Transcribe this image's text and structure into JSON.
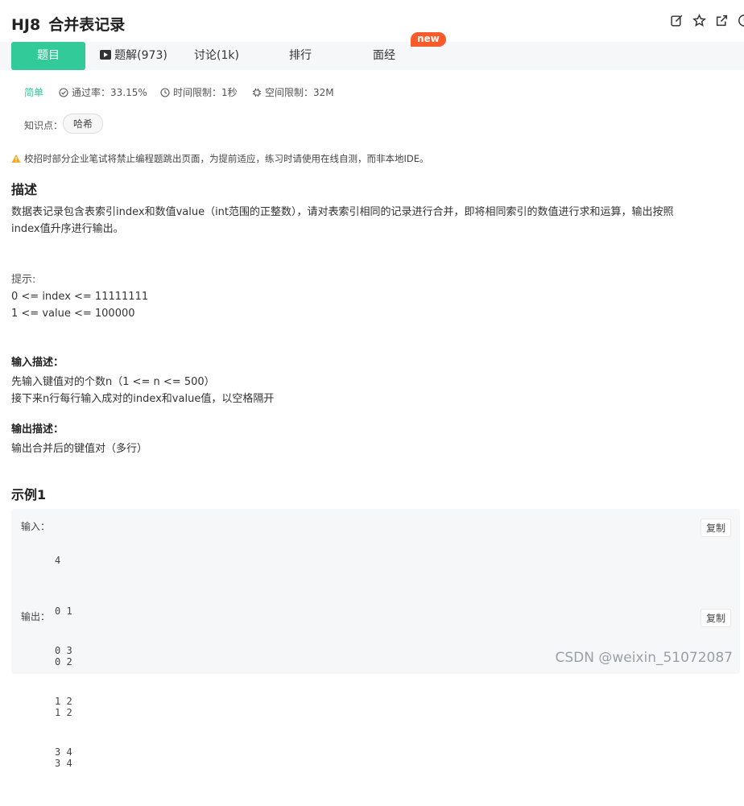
{
  "problem": {
    "id": "HJ8",
    "title": "合并表记录"
  },
  "tabs": [
    {
      "label": "题目",
      "active": true
    },
    {
      "label": "题解(973)"
    },
    {
      "label": "讨论(1k)"
    },
    {
      "label": "排行"
    },
    {
      "label": "面经"
    }
  ],
  "badge": "new",
  "meta": {
    "difficulty": "简单",
    "pass_rate": "通过率：33.15%",
    "time_limit": "时间限制：1秒",
    "space_limit": "空间限制：32M"
  },
  "knowledge": {
    "label": "知识点：",
    "tags": [
      "哈希"
    ]
  },
  "warning": "校招时部分企业笔试将禁止编程题跳出页面，为提前适应，练习时请使用在线自测，而非本地IDE。",
  "description": {
    "title": "描述",
    "lines": [
      "数据表记录包含表索引index和数值value（int范围的正整数），请对表索引相同的记录进行合并，即将相同索引的数值进行求和运算，输出按照",
      "index值升序进行输出。"
    ],
    "hint_label": "提示:",
    "hints": [
      "0 <= index <= 11111111",
      "1 <= value <= 100000"
    ]
  },
  "input_desc": {
    "title": "输入描述：",
    "lines": [
      "先输入键值对的个数n（1 <= n <= 500）",
      "接下来n行每行输入成对的index和value值，以空格隔开"
    ]
  },
  "output_desc": {
    "title": "输出描述：",
    "lines": [
      "输出合并后的键值对（多行）"
    ]
  },
  "example": {
    "title": "示例1",
    "input_label": "输入：",
    "input_lines": [
      "4",
      "0 1",
      "0 2",
      "1 2",
      "3 4"
    ],
    "output_label": "输出：",
    "output_lines": [
      "0 3",
      "1 2",
      "3 4"
    ],
    "copy_label": "复制"
  },
  "watermark": "CSDN @weixin_51072087",
  "colors": {
    "accent": "#32ca99",
    "badge": "#fb5b2b",
    "warning": "#f5a623"
  }
}
